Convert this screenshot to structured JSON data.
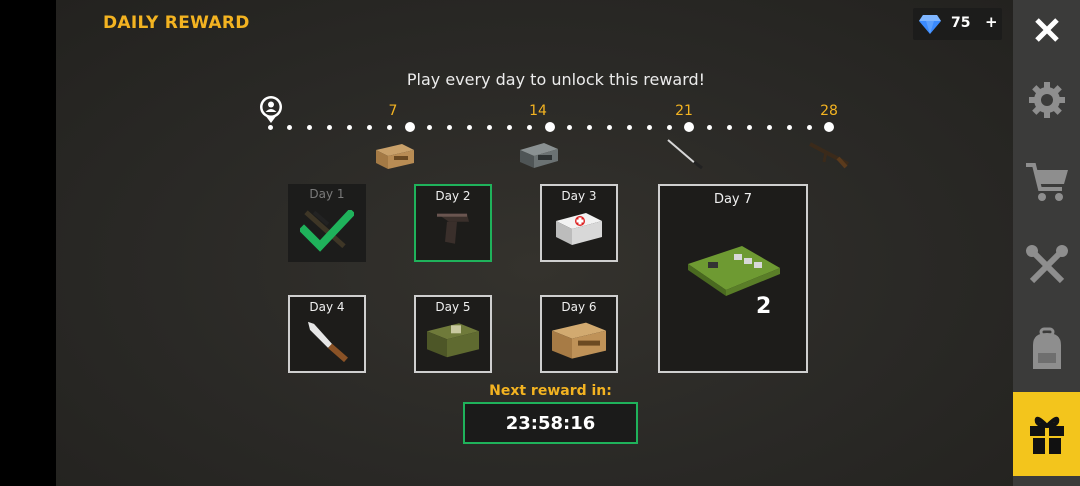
{
  "header": {
    "title": "DAILY REWARD"
  },
  "currency": {
    "amount": "75",
    "plus": "+",
    "icon": "diamond-icon",
    "color": "#3b8bff"
  },
  "subtitle": "Play every day to unlock this reward!",
  "timeline": {
    "milestones": [
      "7",
      "14",
      "21",
      "28"
    ],
    "milestone_rewards": [
      "weapon-crate-icon",
      "metal-case-icon",
      "katana-icon",
      "assault-rifle-icon"
    ]
  },
  "days": [
    {
      "label": "Day 1",
      "state": "claimed",
      "item": "sniper-rifle-icon"
    },
    {
      "label": "Day 2",
      "state": "current",
      "item": "pistol-icon"
    },
    {
      "label": "Day 3",
      "state": "locked",
      "item": "medkit-icon"
    },
    {
      "label": "Day 4",
      "state": "locked",
      "item": "knife-icon"
    },
    {
      "label": "Day 5",
      "state": "locked",
      "item": "ammo-crate-icon"
    },
    {
      "label": "Day 6",
      "state": "locked",
      "item": "weapon-crate-icon"
    },
    {
      "label": "Day 7",
      "state": "locked",
      "item": "circuit-board-icon",
      "quantity": "2"
    }
  ],
  "next_reward": {
    "label": "Next reward in:",
    "timer": "23:58:16"
  },
  "sidebar": {
    "items": [
      "close-icon",
      "gear-icon",
      "cart-icon",
      "tools-icon",
      "backpack-icon",
      "gift-icon"
    ],
    "active": "gift-icon"
  },
  "colors": {
    "accent": "#f3b321",
    "green": "#1fb25b",
    "active_tab": "#f3c51c"
  }
}
